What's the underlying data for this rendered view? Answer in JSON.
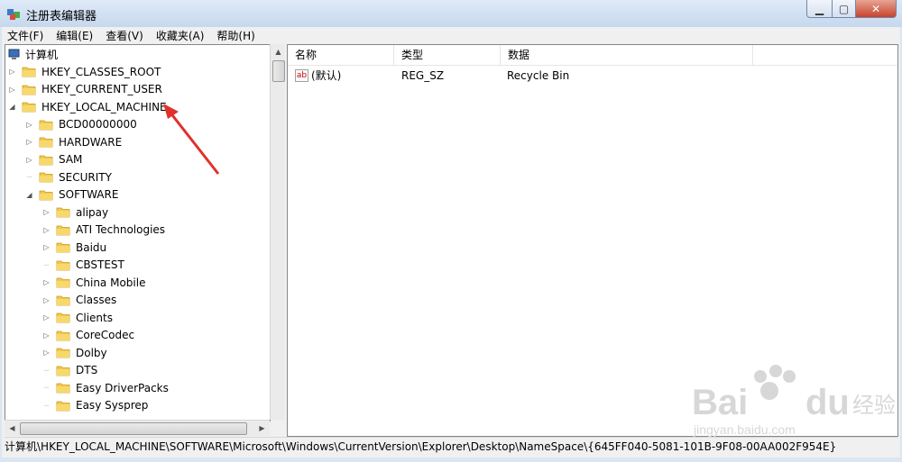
{
  "window": {
    "title": "注册表编辑器"
  },
  "menu": [
    "文件(F)",
    "编辑(E)",
    "查看(V)",
    "收藏夹(A)",
    "帮助(H)"
  ],
  "tree": {
    "root": "计算机",
    "items": [
      {
        "label": "HKEY_CLASSES_ROOT",
        "level": 1,
        "expander": "collapsed"
      },
      {
        "label": "HKEY_CURRENT_USER",
        "level": 1,
        "expander": "collapsed"
      },
      {
        "label": "HKEY_LOCAL_MACHINE",
        "level": 1,
        "expander": "expanded"
      },
      {
        "label": "BCD00000000",
        "level": 2,
        "expander": "collapsed"
      },
      {
        "label": "HARDWARE",
        "level": 2,
        "expander": "collapsed"
      },
      {
        "label": "SAM",
        "level": 2,
        "expander": "collapsed"
      },
      {
        "label": "SECURITY",
        "level": 2,
        "expander": "none"
      },
      {
        "label": "SOFTWARE",
        "level": 2,
        "expander": "expanded"
      },
      {
        "label": "alipay",
        "level": 3,
        "expander": "collapsed"
      },
      {
        "label": "ATI Technologies",
        "level": 3,
        "expander": "collapsed"
      },
      {
        "label": "Baidu",
        "level": 3,
        "expander": "collapsed"
      },
      {
        "label": "CBSTEST",
        "level": 3,
        "expander": "none"
      },
      {
        "label": "China Mobile",
        "level": 3,
        "expander": "collapsed"
      },
      {
        "label": "Classes",
        "level": 3,
        "expander": "collapsed"
      },
      {
        "label": "Clients",
        "level": 3,
        "expander": "collapsed"
      },
      {
        "label": "CoreCodec",
        "level": 3,
        "expander": "collapsed"
      },
      {
        "label": "Dolby",
        "level": 3,
        "expander": "collapsed"
      },
      {
        "label": "DTS",
        "level": 3,
        "expander": "none"
      },
      {
        "label": "Easy DriverPacks",
        "level": 3,
        "expander": "none"
      },
      {
        "label": "Easy Sysprep",
        "level": 3,
        "expander": "none"
      }
    ]
  },
  "list": {
    "columns": [
      "名称",
      "类型",
      "数据"
    ],
    "rows": [
      {
        "name": "(默认)",
        "type": "REG_SZ",
        "data": "Recycle Bin"
      }
    ]
  },
  "status": "计算机\\HKEY_LOCAL_MACHINE\\SOFTWARE\\Microsoft\\Windows\\CurrentVersion\\Explorer\\Desktop\\NameSpace\\{645FF040-5081-101B-9F08-00AA002F954E}",
  "watermark": {
    "brand": "Baidu经验",
    "url": "jingyan.baidu.com"
  },
  "colors": {
    "annotation_arrow": "#e0322a",
    "folder": "#f2c94c"
  }
}
